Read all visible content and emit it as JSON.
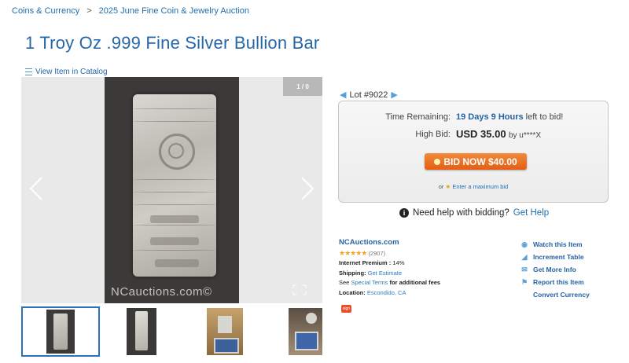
{
  "breadcrumb": {
    "items": [
      "Coins & Currency",
      "2025 June Fine Coin & Jewelry Auction"
    ],
    "separator": ">"
  },
  "title": "1 Troy Oz .999 Fine Silver Bullion Bar",
  "catalog_link": "View Item in Catalog",
  "gallery": {
    "counter": "1 / 0",
    "watermark": "NCauctions.com©",
    "thumbnail_count": 4,
    "selected_index": 0
  },
  "lot": {
    "label": "Lot #9022"
  },
  "bidding": {
    "time_label": "Time Remaining:",
    "time_value": "19 Days 9 Hours",
    "time_suffix": "left to bid!",
    "high_bid_label": "High Bid:",
    "high_bid_value": "USD 35.00",
    "high_bid_by": "by u****X",
    "bid_button": "BID NOW $40.00",
    "max_bid_prefix": "or",
    "max_bid_link": "Enter a maximum bid"
  },
  "help": {
    "text": "Need help with bidding?",
    "link": "Get Help"
  },
  "seller": {
    "name": "NCAuctions.com",
    "stars": "★★★★★",
    "feedback_count": "(2907)",
    "premium_label": "Internet Premium :",
    "premium_value": "14%",
    "shipping_label": "Shipping:",
    "shipping_link": "Get Estimate",
    "terms_prefix": "See",
    "terms_link": "Special Terms",
    "terms_suffix": "for additional fees",
    "location_label": "Location:",
    "location_value": "Escondido, CA",
    "badge": "sign"
  },
  "actions": [
    "Watch this Item",
    "Increment Table",
    "Get More Info",
    "Report this Item",
    "Convert Currency"
  ],
  "colors": {
    "link": "#2563a3",
    "bid_button": "#e35e14",
    "thumb_border": "#2e73b8"
  }
}
